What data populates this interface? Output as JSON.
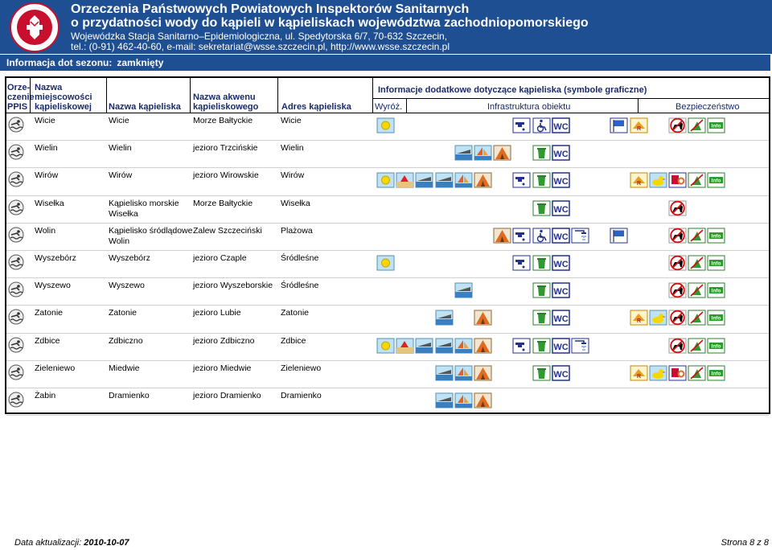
{
  "header": {
    "title_line1": "Orzeczenia Państwowych Powiatowych Inspektorów Sanitarnych",
    "title_line2": "o przydatności wody do kąpieli w kąpieliskach województwa zachodniopomorskiego",
    "address_line": "Wojewódzka Stacja Sanitarno–Epidemiologiczna, ul. Spedytorska 6/7, 70-632 Szczecin,",
    "contact_line": "tel.: (0-91) 462-40-60, e-mail: sekretariat@wsse.szczecin.pl, http://www.wsse.szczecin.pl",
    "logo_text_top": "PAŃSTWOWA",
    "logo_text_bottom": "INSPEKCJA SANITARNA"
  },
  "season": {
    "label": "Informacja dot sezonu:",
    "value": "zamknięty"
  },
  "columns": {
    "orzeczenie_l1": "Orze-",
    "orzeczenie_l2": "czenie",
    "orzeczenie_l3": "PPIS",
    "miejscowosc_l1": "Nazwa",
    "miejscowosc_l2": "miejscowości",
    "miejscowosc_l3": "kąpieliskowej",
    "kapielisko": "Nazwa kąpieliska",
    "akwen_l1": "Nazwa akwenu",
    "akwen_l2": "kąpieliskowego",
    "adres": "Adres kąpieliska",
    "info": "Informacje dodatkowe dotyczące kąpieliska (symbole graficzne)",
    "wyroz": "Wyróż.",
    "infrastruktura": "Infrastruktura obiektu",
    "bezpieczenstwo": "Bezpieczeństwo"
  },
  "rows": [
    {
      "miejscowosc": "Wicie",
      "kapielisko": "Wicie",
      "akwen": "Morze Bałtyckie",
      "adres": "Wicie",
      "icons": [
        "sun",
        "",
        "",
        "",
        "",
        "",
        "",
        "tap",
        "wheelchair",
        "wc",
        "",
        "",
        "flag-blue",
        "lifeguard",
        "",
        "no-dogs",
        "no-fire",
        "info"
      ]
    },
    {
      "miejscowosc": "Wielin",
      "kapielisko": "Wielin",
      "akwen": "jezioro Trzcińskie",
      "adres": "Wielin",
      "icons": [
        "",
        "",
        "",
        "",
        "boat",
        "sailboat",
        "tent",
        "",
        "bin",
        "wc",
        "",
        "",
        "",
        "",
        "",
        "",
        "",
        ""
      ]
    },
    {
      "miejscowosc": "Wirów",
      "kapielisko": "Wirów",
      "akwen": "jezioro Wirowskie",
      "adres": "Wirów",
      "icons": [
        "sun",
        "beach",
        "boat",
        "boat",
        "sailboat",
        "tent",
        "",
        "tap",
        "bin",
        "wc",
        "",
        "",
        "",
        "lifeguard",
        "duck",
        "rescue",
        "no-fire",
        "info"
      ]
    },
    {
      "miejscowosc": "Wisełka",
      "kapielisko_l1": "Kąpielisko morskie",
      "kapielisko_l2": "Wisełka",
      "akwen": "Morze Bałtyckie",
      "adres": "Wisełka",
      "icons": [
        "",
        "",
        "",
        "",
        "",
        "",
        "",
        "",
        "bin",
        "wc",
        "",
        "",
        "",
        "",
        "",
        "no-dogs",
        "",
        ""
      ]
    },
    {
      "miejscowosc": "Wolin",
      "kapielisko_l1": "Kąpielisko śródlądowe",
      "kapielisko_l2": "Wolin",
      "akwen": "Zalew Szczeciński",
      "adres": "Plażowa",
      "icons": [
        "",
        "",
        "",
        "",
        "",
        "",
        "tent",
        "tap",
        "wheelchair",
        "wc",
        "shower",
        "",
        "flag-blue",
        "",
        "",
        "no-dogs",
        "no-fire",
        "info"
      ]
    },
    {
      "miejscowosc": "Wyszebórz",
      "kapielisko": "Wyszebórz",
      "akwen": "jezioro Czaple",
      "adres": "Śródleśne",
      "icons": [
        "sun",
        "",
        "",
        "",
        "",
        "",
        "",
        "tap",
        "bin",
        "wc",
        "",
        "",
        "",
        "",
        "",
        "no-dogs",
        "no-fire",
        "info"
      ]
    },
    {
      "miejscowosc": "Wyszewo",
      "kapielisko": "Wyszewo",
      "akwen": "jezioro Wyszeborskie",
      "adres": "Śródleśne",
      "icons": [
        "",
        "",
        "",
        "",
        "boat",
        "",
        "",
        "",
        "bin",
        "wc",
        "",
        "",
        "",
        "",
        "",
        "no-dogs",
        "no-fire",
        "info"
      ]
    },
    {
      "miejscowosc": "Zatonie",
      "kapielisko": "Zatonie",
      "akwen": "jezioro Lubie",
      "adres": "Zatonie",
      "icons": [
        "",
        "",
        "",
        "boat",
        "",
        "tent",
        "",
        "",
        "bin",
        "wc",
        "",
        "",
        "",
        "lifeguard",
        "duck",
        "no-dogs",
        "no-fire",
        "info"
      ]
    },
    {
      "miejscowosc": "Zdbice",
      "kapielisko": "Zdbiczno",
      "akwen": "jezioro Zdbiczno",
      "adres": "Zdbice",
      "icons": [
        "sun",
        "beach",
        "boat",
        "boat",
        "sailboat",
        "tent",
        "",
        "tap",
        "bin",
        "wc",
        "shower",
        "",
        "",
        "",
        "",
        "no-dogs",
        "no-fire",
        "info"
      ]
    },
    {
      "miejscowosc": "Zieleniewo",
      "kapielisko": "Miedwie",
      "akwen": "jezioro Miedwie",
      "adres": "Zieleniewo",
      "icons": [
        "",
        "",
        "",
        "boat",
        "sailboat",
        "tent",
        "",
        "",
        "bin",
        "wc",
        "",
        "",
        "",
        "lifeguard",
        "duck",
        "rescue",
        "no-fire",
        "info"
      ]
    },
    {
      "miejscowosc": "Żabin",
      "kapielisko": "Dramienko",
      "akwen": "jezioro Dramienko",
      "adres": "Dramienko",
      "icons": [
        "",
        "",
        "",
        "boat",
        "sailboat",
        "tent",
        "",
        "",
        "",
        "",
        "",
        "",
        "",
        "",
        "",
        "",
        "",
        ""
      ]
    }
  ],
  "footer": {
    "updated_label": "Data aktualizacji:",
    "updated_value": "2010-10-07",
    "page": "Strona 8 z 8"
  },
  "colors": {
    "banner": "#1f4f93",
    "header_text": "#1a2a6b"
  }
}
